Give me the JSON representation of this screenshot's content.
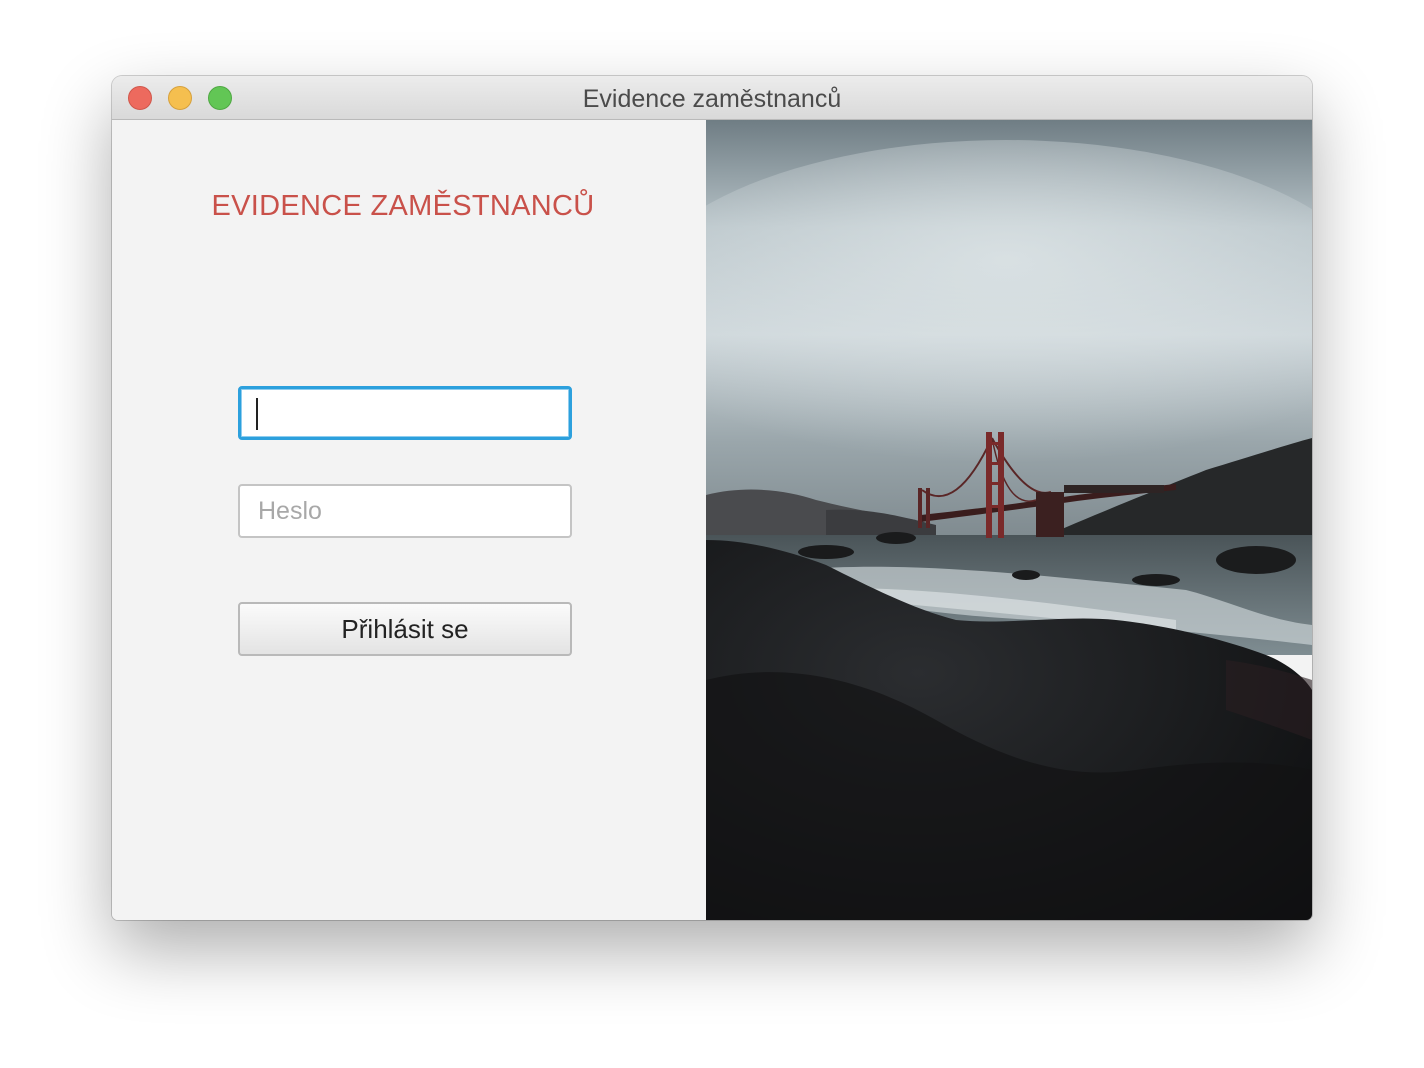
{
  "window": {
    "title": "Evidence zaměstnanců",
    "controls": [
      "close",
      "minimize",
      "zoom"
    ]
  },
  "login": {
    "heading": "EVIDENCE ZAMĚSTNANCŮ",
    "username": {
      "value": "",
      "placeholder": ""
    },
    "password": {
      "value": "",
      "placeholder": "Heslo"
    },
    "submit_label": "Přihlásit se"
  },
  "image": {
    "description_icon": "bridge-photo",
    "sky": "#c9d3d8",
    "bridge_color": "#7a2a2a",
    "rock": "#141517"
  },
  "colors": {
    "heading": "#c9514a",
    "focus_ring": "#2ca0dd"
  }
}
